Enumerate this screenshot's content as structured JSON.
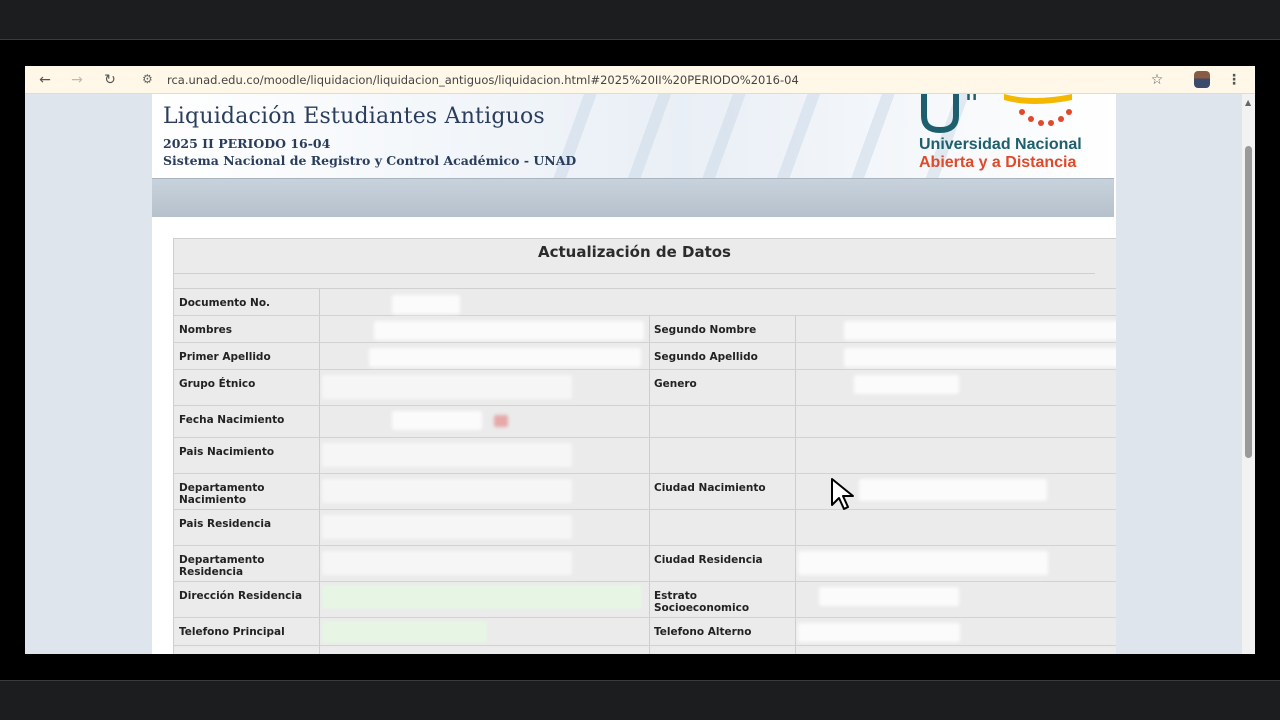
{
  "browser": {
    "url": "rca.unad.edu.co/moodle/liquidacion/liquidacion_antiguos/liquidacion.html#2025%20II%20PERIODO%2016-04",
    "icons": [
      "back-arrow-icon",
      "forward-arrow-icon",
      "reload-icon",
      "site-info-icon",
      "star-icon",
      "profile-avatar",
      "menu-kebab-icon"
    ]
  },
  "header": {
    "title": "Liquidación Estudiantes Antiguos",
    "period": "2025 II PERIODO 16-04",
    "system": "Sistema Nacional de Registro y Control Académico - UNAD",
    "logo_line1": "Universidad Nacional",
    "logo_line2": "Abierta y a Distancia"
  },
  "form": {
    "title": "Actualización de Datos",
    "labels": {
      "documento": "Documento No.",
      "nombres": "Nombres",
      "segundo_nombre": "Segundo Nombre",
      "primer_apellido": "Primer Apellido",
      "segundo_apellido": "Segundo Apellido",
      "grupo_etnico": "Grupo Étnico",
      "genero": "Genero",
      "fecha_nacimiento": "Fecha Nacimiento",
      "pais_nacimiento": "Pais Nacimiento",
      "departamento_nacimiento": "Departamento Nacimiento",
      "ciudad_nacimiento": "Ciudad Nacimiento",
      "pais_residencia": "Pais Residencia",
      "departamento_residencia": "Departamento Residencia",
      "ciudad_residencia": "Ciudad Residencia",
      "direccion_residencia": "Dirección Residencia",
      "estrato": "Estrato Socioeconomico",
      "telefono_principal": "Telefono Principal",
      "telefono_alterno": "Telefono Alterno"
    }
  },
  "colors": {
    "title_blue": "#2a3d5c",
    "logo_teal": "#1e5f6e",
    "logo_orange": "#e0492a",
    "logo_yellow": "#f5b800",
    "form_bg": "#ebebeb"
  }
}
